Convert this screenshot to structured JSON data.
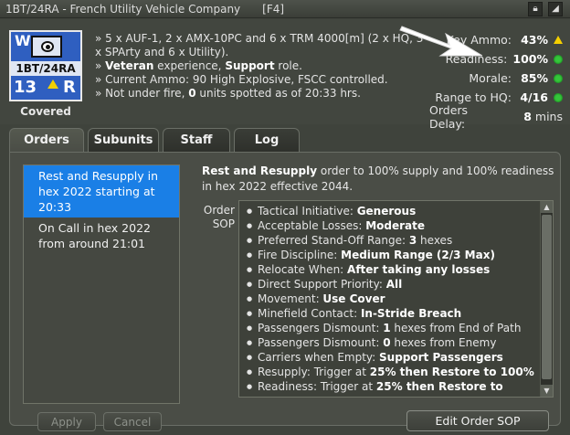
{
  "window": {
    "title": "1BT/24RA - French Utility Vehicle Company",
    "hotkey": "[F4]",
    "icons": [
      "lock-icon",
      "minimize-icon"
    ]
  },
  "unit": {
    "symbol_left": "W",
    "name": "1BT/24RA",
    "number": "13",
    "corner": "R",
    "status": "Covered",
    "colors": {
      "card": "#2f5fc0",
      "selected": "#1a7fe6",
      "ok": "#35c63b",
      "warn": "#f5d000"
    }
  },
  "description": {
    "line1": "» 5 x AUF-1, 2 x AMX-10PC and 6 x TRM 4000[m] (2 x HQ, 3 x SPArty and 6 x Utility).",
    "line2_pre": "» ",
    "line2_b1": "Veteran",
    "line2_mid": " experience, ",
    "line2_b2": "Support",
    "line2_post": " role.",
    "line3": "» Current Ammo: 90 High Explosive, FSCC controlled.",
    "line4_pre": "» Not under fire, ",
    "line4_b": "0",
    "line4_post": " units spotted as of 20:33 hrs."
  },
  "stats": [
    {
      "label": "Key Ammo:",
      "value": "43%",
      "indicator": "warn"
    },
    {
      "label": "Readiness:",
      "value": "100%",
      "indicator": "ok"
    },
    {
      "label": "Morale:",
      "value": "85%",
      "indicator": "ok"
    },
    {
      "label": "Range to HQ:",
      "value": "4/16",
      "indicator": "ok"
    },
    {
      "label": "Orders Delay:",
      "value": "8",
      "unit": "mins"
    }
  ],
  "tabs": [
    "Orders",
    "Subunits",
    "Staff",
    "Log"
  ],
  "active_tab": "Orders",
  "orders": [
    {
      "text": "Rest and Resupply in hex 2022 starting at 20:33",
      "selected": true
    },
    {
      "text": "On Call in hex 2022 from around 21:01",
      "selected": false
    }
  ],
  "summary": {
    "bold": "Rest and Resupply",
    "rest": " order to 100% supply and 100% readiness in hex 2022 effective 2044."
  },
  "sop_label": [
    "Order",
    "SOP"
  ],
  "sop": [
    {
      "label": "Tactical Initiative: ",
      "value": "Generous",
      "suffix": ""
    },
    {
      "label": "Acceptable Losses: ",
      "value": "Moderate",
      "suffix": ""
    },
    {
      "label": "Preferred Stand-Off Range: ",
      "value": "3",
      "suffix": " hexes"
    },
    {
      "label": "Fire Discipline: ",
      "value": "Medium Range (2/3 Max)",
      "suffix": ""
    },
    {
      "label": "Relocate When: ",
      "value": "After taking any losses",
      "suffix": ""
    },
    {
      "label": "Direct Support Priority: ",
      "value": "All",
      "suffix": ""
    },
    {
      "label": "Movement: ",
      "value": "Use Cover",
      "suffix": ""
    },
    {
      "label": "Minefield Contact: ",
      "value": "In-Stride Breach",
      "suffix": ""
    },
    {
      "label": "Passengers Dismount: ",
      "value": "1",
      "suffix": " hexes from End of Path"
    },
    {
      "label": "Passengers Dismount: ",
      "value": "0",
      "suffix": " hexes from Enemy"
    },
    {
      "label": "Carriers when Empty: ",
      "value": "Support Passengers",
      "suffix": ""
    },
    {
      "label": "Resupply: Trigger at ",
      "value": "25% then Restore to 100%",
      "suffix": ""
    },
    {
      "label": "Readiness: Trigger at ",
      "value": "25% then Restore to",
      "suffix": ""
    }
  ],
  "buttons": {
    "apply": "Apply",
    "cancel": "Cancel",
    "edit_sop": "Edit Order SOP"
  }
}
